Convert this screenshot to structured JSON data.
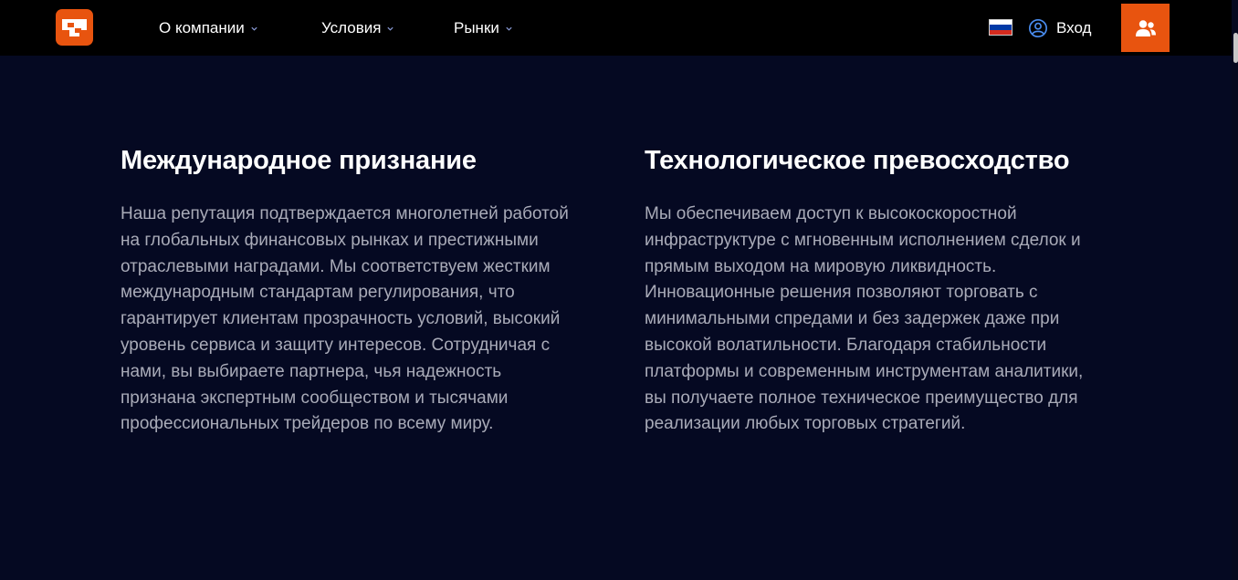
{
  "header": {
    "logo_icon": "brand-logo-icon",
    "nav": [
      {
        "label": "О компании",
        "icon": "chevron-down-icon"
      },
      {
        "label": "Условия",
        "icon": "chevron-down-icon"
      },
      {
        "label": "Рынки",
        "icon": "chevron-down-icon"
      }
    ],
    "language_flag": "russia-flag-icon",
    "login_label": "Вход",
    "login_icon": "user-circle-icon",
    "register_icon": "users-icon"
  },
  "sections": [
    {
      "title": "Международное признание",
      "text": "Наша репутация подтверждается многолетней работой на глобальных финансовых рынках и престижными отраслевыми наградами. Мы соответствуем жестким международным стандартам регулирования, что гарантирует клиентам прозрачность условий, высокий уровень сервиса и защиту интересов. Сотрудничая с нами, вы выбираете партнера, чья надежность признана экспертным сообществом и тысячами профессиональных трейдеров по всему миру."
    },
    {
      "title": "Технологическое превосходство",
      "text": "Мы обеспечиваем доступ к высокоскоростной инфраструктуре с мгновенным исполнением сделок и прямым выходом на мировую ликвидность. Инновационные решения позволяют торговать с минимальными спредами и без задержек даже при высокой волатильности. Благодаря стабильности платформы и современным инструментам аналитики, вы получаете полное техническое преимущество для реализации любых торговых стратегий."
    }
  ],
  "colors": {
    "accent": "#e8540f",
    "header_bg": "#000000",
    "page_bg": "#050922",
    "body_text": "#a9abb8",
    "heading_text": "#ffffff"
  }
}
